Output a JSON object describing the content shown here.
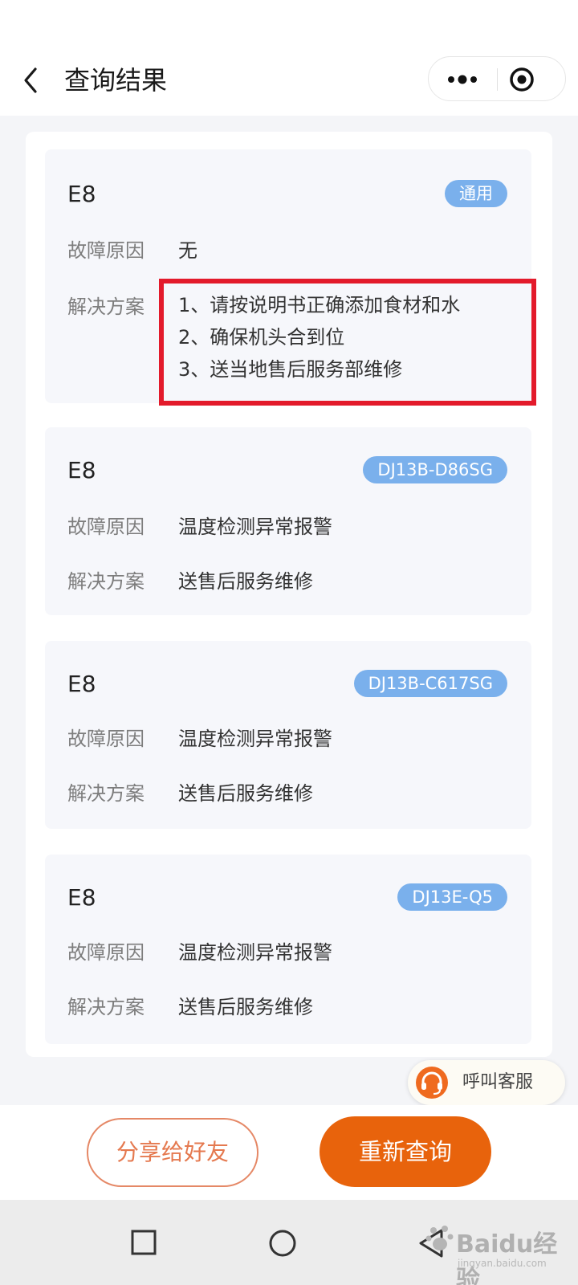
{
  "nav": {
    "title": "查询结果"
  },
  "cards": [
    {
      "code": "E8",
      "tag": "通用",
      "cause_label": "故障原因",
      "cause": "无",
      "solution_label": "解决方案",
      "solutions": [
        "1、请按说明书正确添加食材和水",
        "2、确保机头合到位",
        "3、送当地售后服务部维修"
      ]
    },
    {
      "code": "E8",
      "tag": "DJ13B-D86SG",
      "cause_label": "故障原因",
      "cause": "温度检测异常报警",
      "solution_label": "解决方案",
      "solution": "送售后服务维修"
    },
    {
      "code": "E8",
      "tag": "DJ13B-C617SG",
      "cause_label": "故障原因",
      "cause": "温度检测异常报警",
      "solution_label": "解决方案",
      "solution": "送售后服务维修"
    },
    {
      "code": "E8",
      "tag": "DJ13E-Q5",
      "cause_label": "故障原因",
      "cause": "温度检测异常报警",
      "solution_label": "解决方案",
      "solution": "送售后服务维修"
    }
  ],
  "customer_service": {
    "label": "呼叫客服"
  },
  "actions": {
    "share": "分享给好友",
    "requery": "重新查询"
  },
  "watermark": {
    "text": "Baidu经验",
    "sub": "jingyan.baidu.com"
  },
  "colors": {
    "accent": "#e8630c",
    "tag": "#7ab0ec",
    "highlight": "#e31a2b"
  }
}
